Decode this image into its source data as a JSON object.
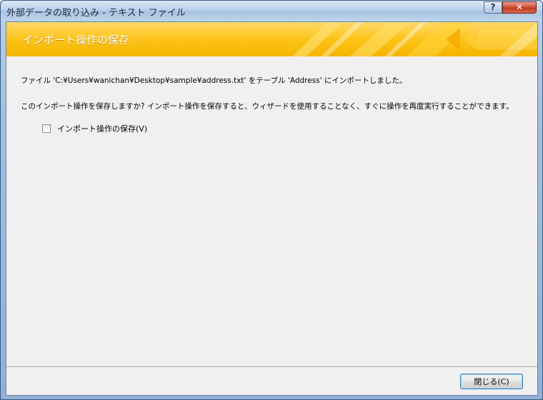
{
  "window": {
    "title": "外部データの取り込み - テキスト ファイル",
    "help_label": "?",
    "close_label": "✕"
  },
  "banner": {
    "title": "インポート操作の保存"
  },
  "content": {
    "message": "ファイル 'C:¥Users¥wanichan¥Desktop¥sample¥address.txt' をテーブル 'Address' にインポートしました。",
    "question": "このインポート操作を保存しますか? インポート操作を保存すると、ウィザードを使用することなく、すぐに操作を再度実行することができます。",
    "save_checkbox_label": "インポート操作の保存(V)",
    "save_checkbox_checked": false
  },
  "footer": {
    "close_button_label": "閉じる(C)"
  },
  "colors": {
    "banner": "#fcc419",
    "client_background": "#f0f0f0",
    "close_button": "#c03b22"
  }
}
